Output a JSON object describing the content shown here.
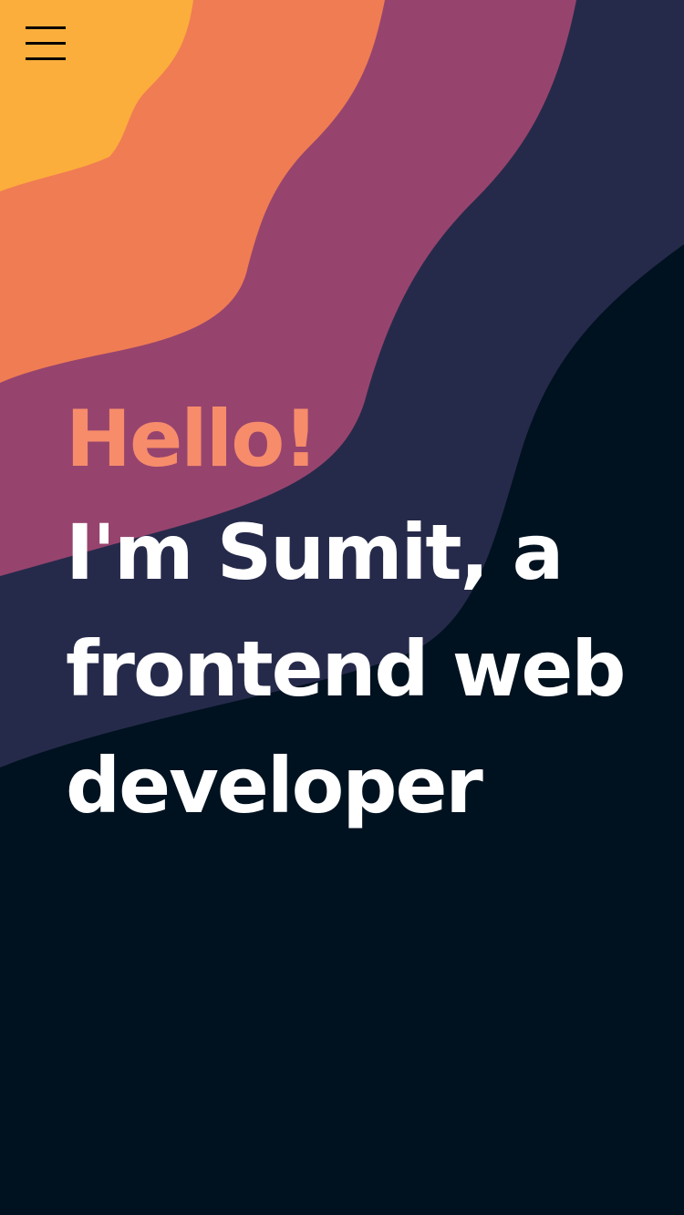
{
  "theme": {
    "background": "#001220",
    "wave_colors": [
      "#FBAE3C",
      "#F07C53",
      "#96446E",
      "#262A4A"
    ],
    "greeting_color": "#F78C6B",
    "headline_color": "#FFFFFF",
    "menu_icon_color": "#000000"
  },
  "header": {
    "menu_icon": "hamburger-menu-icon"
  },
  "hero": {
    "greeting": "Hello!",
    "headline": "I'm Sumit, a frontend web developer"
  }
}
